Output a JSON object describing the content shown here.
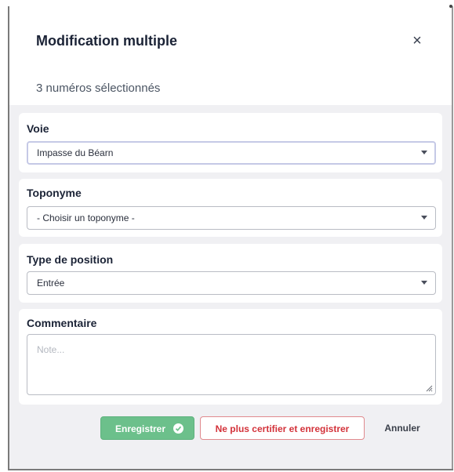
{
  "dialog": {
    "title": "Modification multiple",
    "close_symbol": "×",
    "selected_count": "3 numéros sélectionnés"
  },
  "fields": {
    "voie": {
      "label": "Voie",
      "value": "Impasse du Béarn"
    },
    "toponyme": {
      "label": "Toponyme",
      "value": "- Choisir un toponyme -"
    },
    "type_position": {
      "label": "Type de position",
      "value": "Entrée"
    },
    "commentaire": {
      "label": "Commentaire",
      "placeholder": "Note..."
    }
  },
  "buttons": {
    "save": "Enregistrer",
    "decertify_save": "Ne plus certifier et enregistrer",
    "cancel": "Annuler"
  },
  "icons": {
    "close": "close-icon",
    "caret": "chevron-down-icon",
    "check": "check-circle-icon",
    "resize": "resize-handle-icon"
  },
  "colors": {
    "save_button": "#6cc08b",
    "decertify_text": "#d3323a",
    "decertify_border": "#e08a8e",
    "body_background": "#f0f0f3"
  }
}
